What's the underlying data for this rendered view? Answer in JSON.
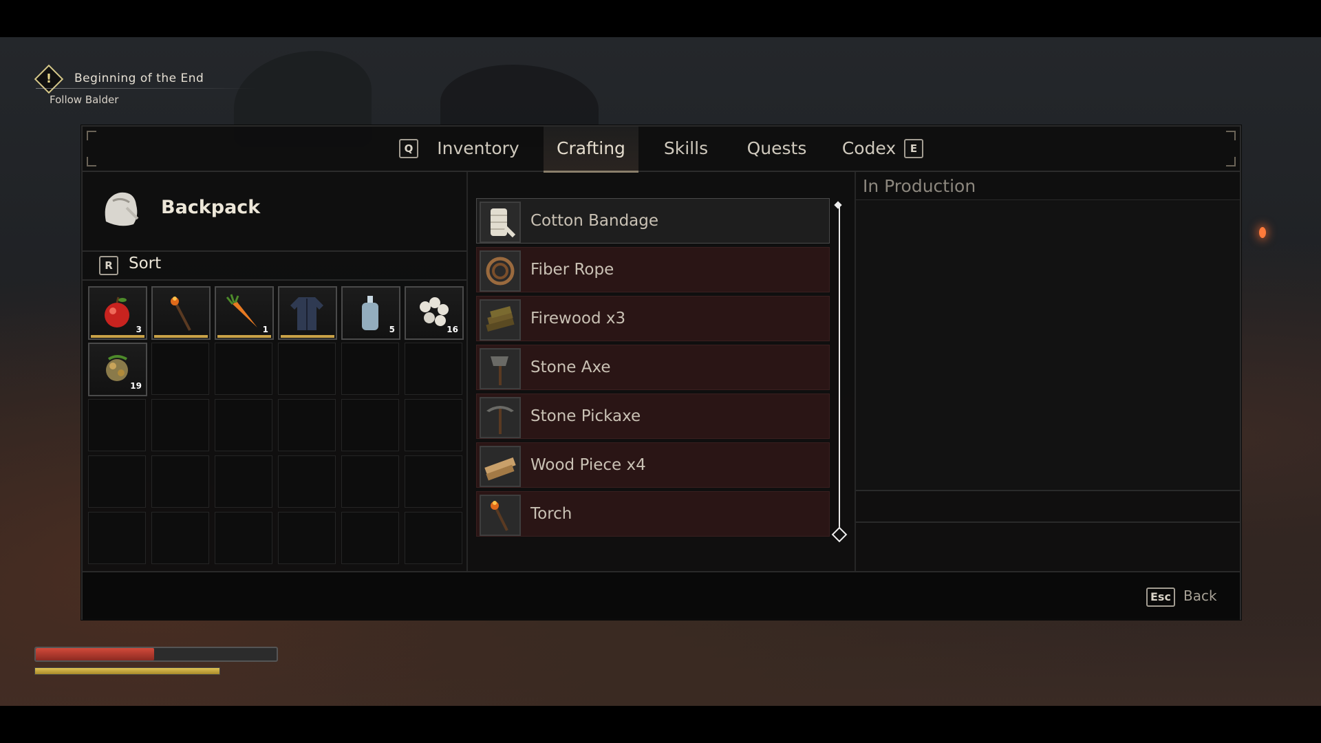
{
  "quest": {
    "title": "Beginning of the End",
    "objective": "Follow Balder"
  },
  "tabs": {
    "prev_key": "Q",
    "next_key": "E",
    "items": [
      {
        "label": "Inventory"
      },
      {
        "label": "Crafting"
      },
      {
        "label": "Skills"
      },
      {
        "label": "Quests"
      },
      {
        "label": "Codex"
      }
    ],
    "active": "Crafting"
  },
  "backpack": {
    "title": "Backpack",
    "sort_key": "R",
    "sort_label": "Sort",
    "slots": [
      {
        "icon": "apple-icon",
        "qty": "3",
        "durability": true
      },
      {
        "icon": "torch-icon",
        "qty": "",
        "durability": true
      },
      {
        "icon": "carrot-icon",
        "qty": "1",
        "durability": true
      },
      {
        "icon": "tunic-icon",
        "qty": "",
        "durability": true
      },
      {
        "icon": "bottle-icon",
        "qty": "5",
        "durability": false
      },
      {
        "icon": "cotton-icon",
        "qty": "16",
        "durability": false
      },
      {
        "icon": "seeds-icon",
        "qty": "19",
        "durability": false
      }
    ]
  },
  "recipes": [
    {
      "label": "Cotton Bandage",
      "icon": "bandage-icon",
      "selected": true
    },
    {
      "label": "Fiber Rope",
      "icon": "rope-icon",
      "selected": false
    },
    {
      "label": "Firewood x3",
      "icon": "firewood-icon",
      "selected": false
    },
    {
      "label": "Stone Axe",
      "icon": "axe-icon",
      "selected": false
    },
    {
      "label": "Stone Pickaxe",
      "icon": "pickaxe-icon",
      "selected": false
    },
    {
      "label": "Wood Piece x4",
      "icon": "wood-piece-icon",
      "selected": false
    },
    {
      "label": "Torch",
      "icon": "torch-icon",
      "selected": false
    }
  ],
  "production": {
    "title": "In Production"
  },
  "footer": {
    "back_key": "Esc",
    "back_label": "Back"
  },
  "status": {
    "health_fraction": 0.49,
    "stamina_fraction": 1.0,
    "health_color": "#c8402f",
    "stamina_color": "#d2b445"
  }
}
